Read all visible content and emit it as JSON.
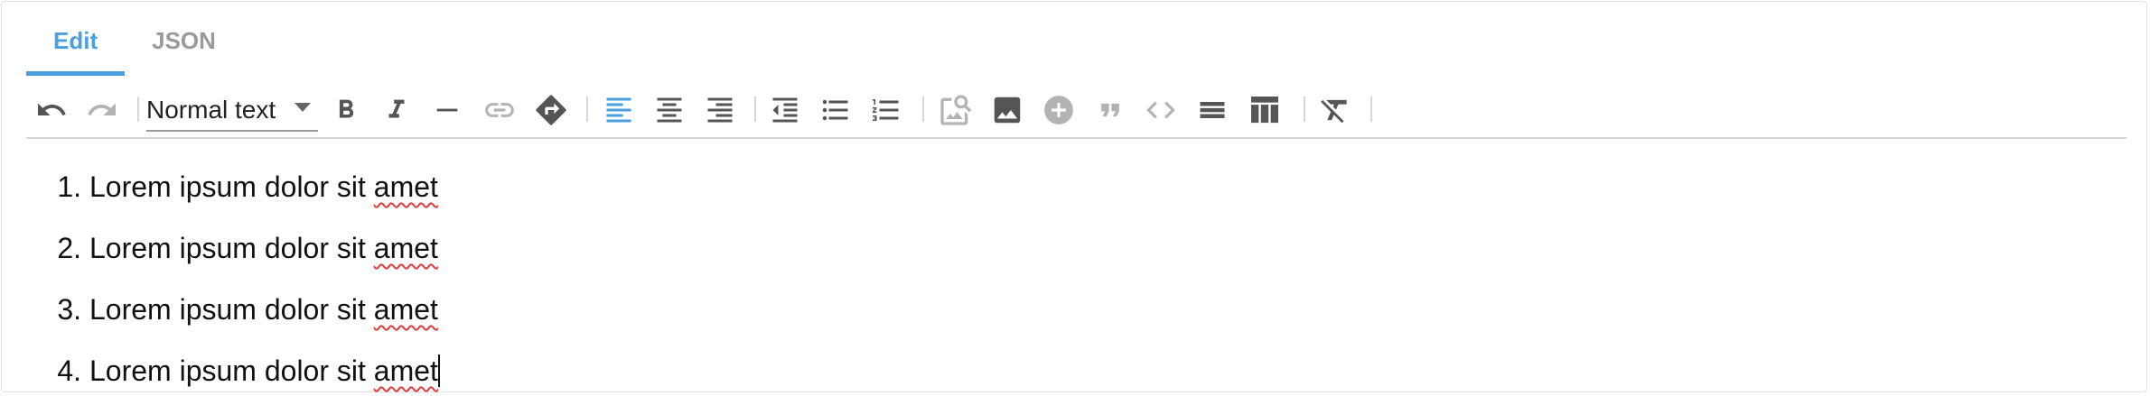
{
  "tabs": [
    {
      "label": "Edit",
      "active": true
    },
    {
      "label": "JSON",
      "active": false
    }
  ],
  "toolbar": {
    "format_select_value": "Normal text",
    "buttons": [
      "undo-icon",
      "redo-icon",
      "bold-icon",
      "italic-icon",
      "horizontal-rule-icon",
      "link-icon",
      "formula-icon",
      "align-left-icon",
      "align-center-icon",
      "align-right-icon",
      "outdent-icon",
      "bullet-list-icon",
      "numbered-list-icon",
      "image-search-icon",
      "image-icon",
      "add-icon",
      "quote-icon",
      "code-icon",
      "divider-icon",
      "table-icon",
      "clear-format-icon"
    ],
    "active_alignment": "left"
  },
  "content": {
    "items": [
      {
        "num": "1.",
        "text": "Lorem ipsum dolor sit ",
        "misspelled": "amet"
      },
      {
        "num": "2.",
        "text": "Lorem ipsum dolor sit ",
        "misspelled": "amet"
      },
      {
        "num": "3.",
        "text": "Lorem ipsum dolor sit ",
        "misspelled": "amet"
      },
      {
        "num": "4.",
        "text": "Lorem ipsum dolor sit ",
        "misspelled": "amet"
      }
    ]
  },
  "colors": {
    "accent": "#4a9fe0",
    "icon": "#555555",
    "icon_disabled": "#b3b3b3",
    "spell_underline": "#e03c3c"
  }
}
